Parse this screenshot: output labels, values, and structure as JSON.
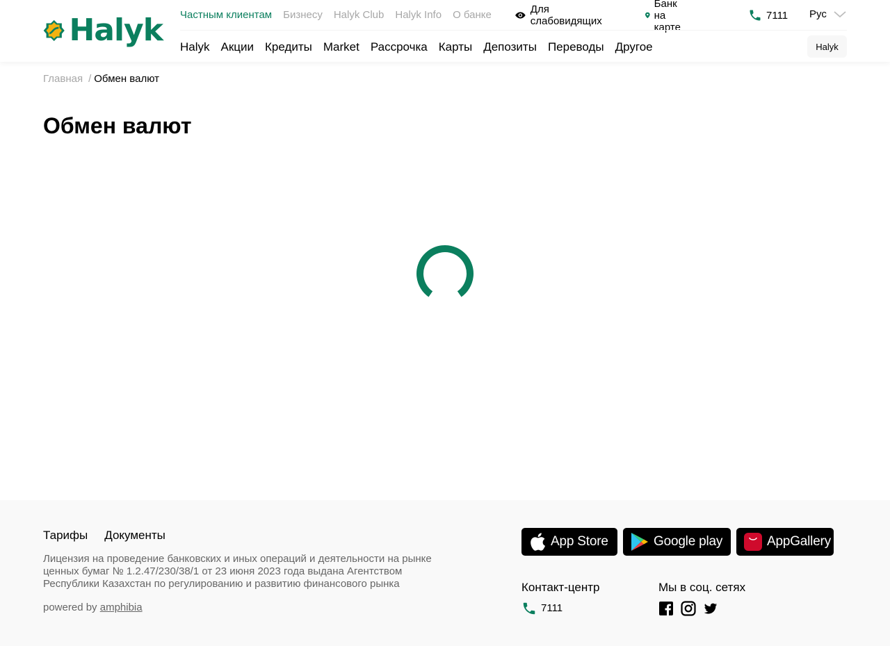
{
  "brand": {
    "name": "Halyk",
    "color": "#0b7f5e",
    "accent": "#f2b310"
  },
  "top_nav": [
    {
      "label": "Частным клиентам",
      "active": true
    },
    {
      "label": "Бизнесу",
      "active": false
    },
    {
      "label": "Halyk Club",
      "active": false
    },
    {
      "label": "Halyk Info",
      "active": false
    },
    {
      "label": "О банке",
      "active": false
    }
  ],
  "utilities": {
    "accessibility": {
      "label": "Для слабовидящих",
      "icon": "eye-icon"
    },
    "map": {
      "label": "Банк на карте",
      "icon": "map-pin-icon"
    },
    "phone": {
      "label": "7111",
      "icon": "phone-icon"
    },
    "language": {
      "label": "Рус",
      "icon": "chevron-down-icon"
    }
  },
  "main_nav": [
    {
      "label": "Halyk"
    },
    {
      "label": "Акции"
    },
    {
      "label": "Кредиты"
    },
    {
      "label": "Market"
    },
    {
      "label": "Рассрочка"
    },
    {
      "label": "Карты"
    },
    {
      "label": "Депозиты"
    },
    {
      "label": "Переводы"
    },
    {
      "label": "Другое"
    }
  ],
  "header_button": {
    "label": "Halyk"
  },
  "breadcrumb": {
    "home": "Главная",
    "separator": "/",
    "current": "Обмен валют"
  },
  "page": {
    "title": "Обмен валют",
    "state": "loading"
  },
  "footer": {
    "links": [
      {
        "label": "Тарифы"
      },
      {
        "label": "Документы"
      }
    ],
    "license": "Лицензия на проведение банковских и иных операций и деятельности на рынке ценных бумаг № 1.2.47/230/38/1 от 23 июня 2023 года выдана Агентством Республики Казахстан по регулированию и развитию финансового рынка",
    "powered_prefix": "powered by",
    "powered_link": "amphibia",
    "stores": [
      {
        "label": "App Store",
        "icon": "apple-icon"
      },
      {
        "label": "Google play",
        "icon": "google-play-icon"
      },
      {
        "label": "AppGallery",
        "icon": "huawei-icon"
      }
    ],
    "contact": {
      "title": "Контакт-центр",
      "phone": "7111"
    },
    "social": {
      "title": "Мы в соц. сетях",
      "icons": [
        "facebook-icon",
        "instagram-icon",
        "twitter-icon"
      ]
    }
  }
}
